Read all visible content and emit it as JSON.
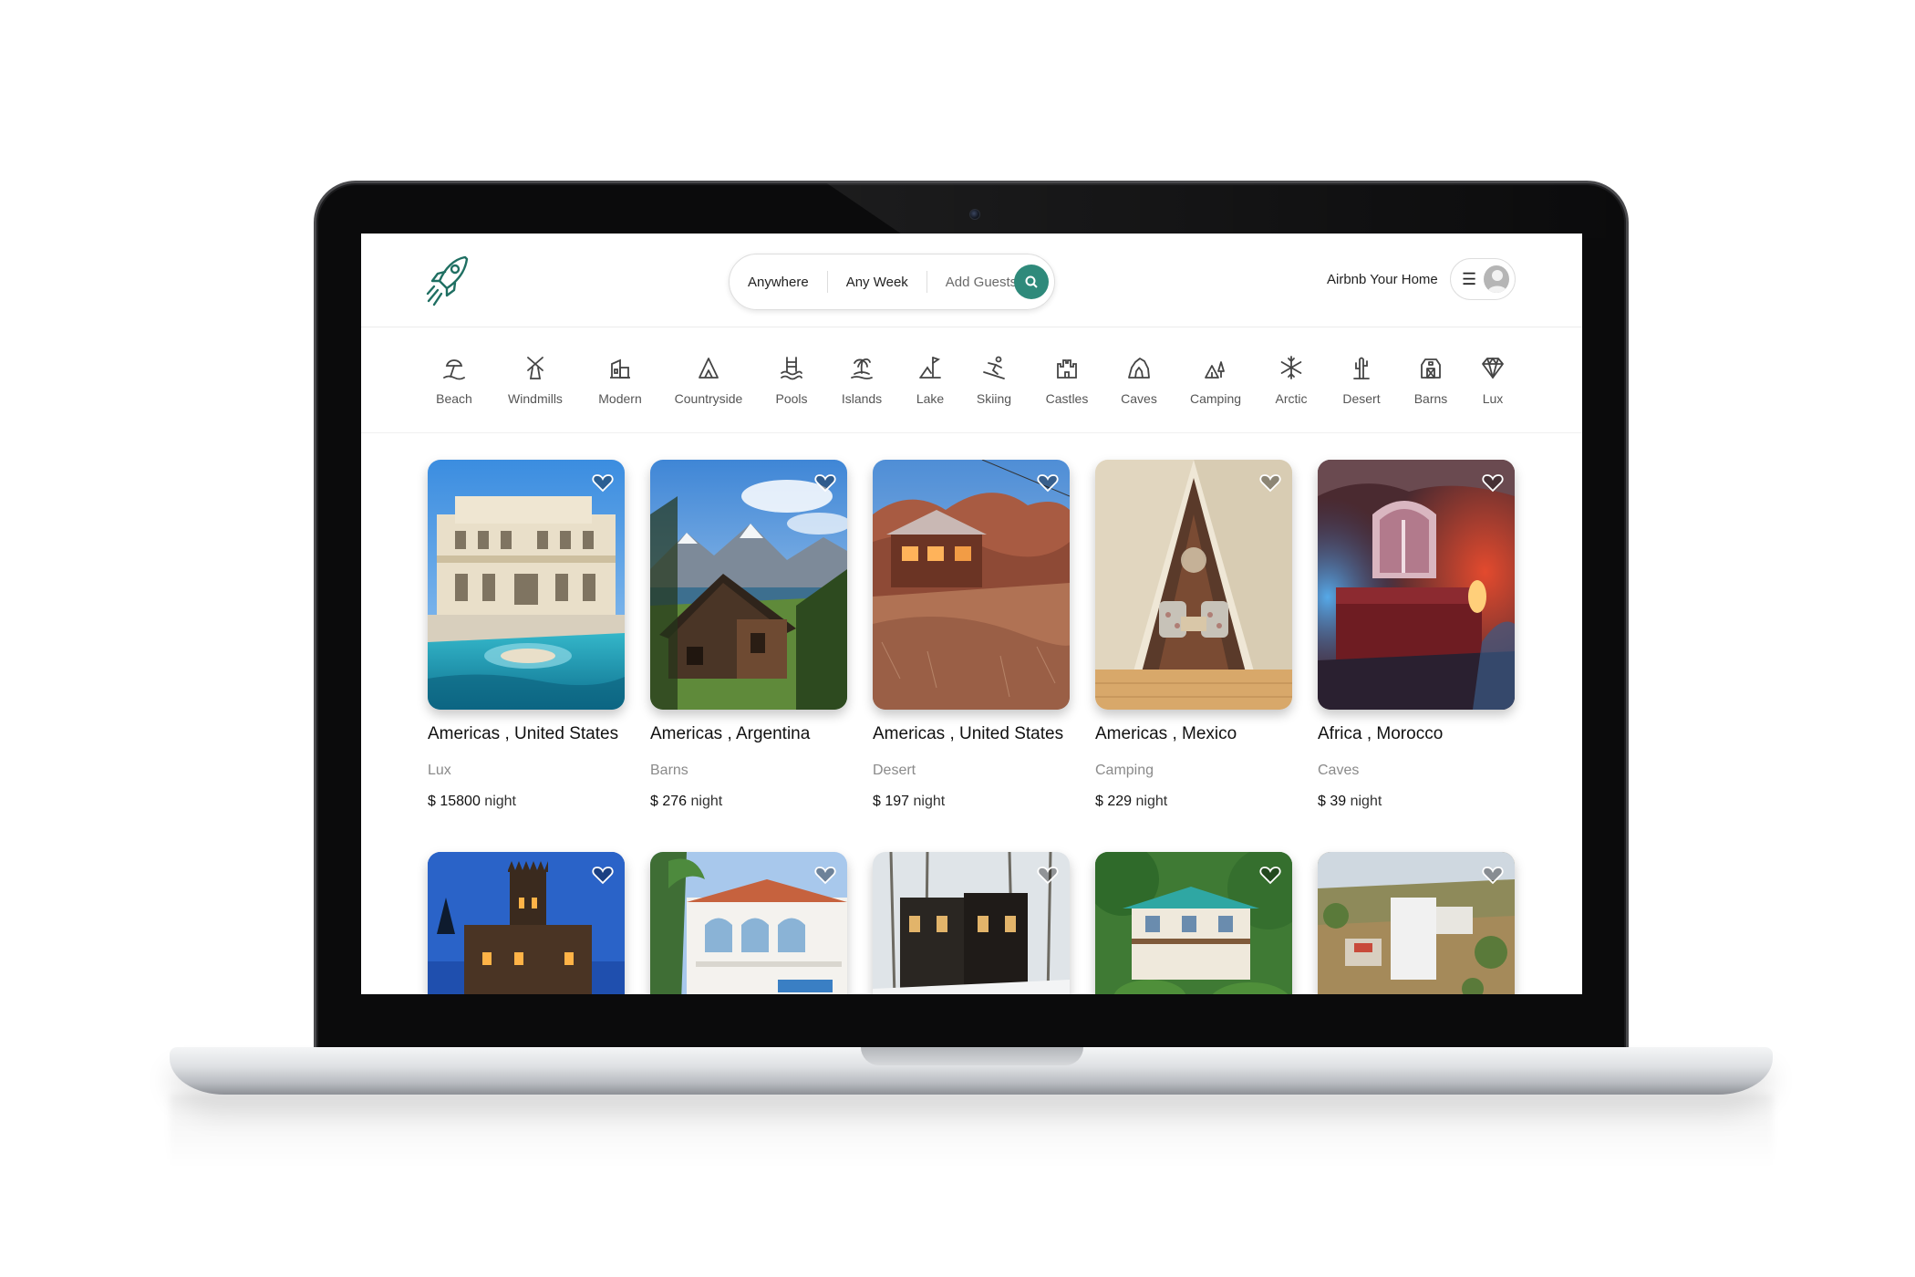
{
  "app": {
    "logo_icon": "rocket-icon",
    "accent_color": "#2f8a7b"
  },
  "search": {
    "where": "Anywhere",
    "when": "Any Week",
    "guests": "Add Guests",
    "button_icon": "search-icon"
  },
  "header": {
    "host_link": "Airbnb Your Home",
    "menu_icon": "☰",
    "avatar_icon": "user-avatar-icon"
  },
  "categories": [
    {
      "label": "Beach",
      "icon": "beach-icon"
    },
    {
      "label": "Windmills",
      "icon": "windmill-icon"
    },
    {
      "label": "Modern",
      "icon": "modern-house-icon"
    },
    {
      "label": "Countryside",
      "icon": "countryside-icon"
    },
    {
      "label": "Pools",
      "icon": "pool-icon"
    },
    {
      "label": "Islands",
      "icon": "island-icon"
    },
    {
      "label": "Lake",
      "icon": "lake-icon"
    },
    {
      "label": "Skiing",
      "icon": "skiing-icon"
    },
    {
      "label": "Castles",
      "icon": "castle-icon"
    },
    {
      "label": "Caves",
      "icon": "cave-icon"
    },
    {
      "label": "Camping",
      "icon": "camping-icon"
    },
    {
      "label": "Arctic",
      "icon": "snowflake-icon"
    },
    {
      "label": "Desert",
      "icon": "cactus-icon"
    },
    {
      "label": "Barns",
      "icon": "barn-icon"
    },
    {
      "label": "Lux",
      "icon": "diamond-icon"
    }
  ],
  "listings": [
    {
      "location": "Americas , United States",
      "category": "Lux",
      "price": "$ 15800",
      "unit": "night"
    },
    {
      "location": "Americas , Argentina",
      "category": "Barns",
      "price": "$ 276",
      "unit": "night"
    },
    {
      "location": "Americas , United States",
      "category": "Desert",
      "price": "$ 197",
      "unit": "night"
    },
    {
      "location": "Americas , Mexico",
      "category": "Camping",
      "price": "$ 229",
      "unit": "night"
    },
    {
      "location": "Africa , Morocco",
      "category": "Caves",
      "price": "$ 39",
      "unit": "night"
    }
  ]
}
